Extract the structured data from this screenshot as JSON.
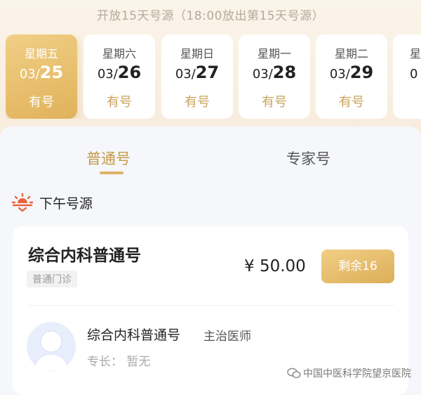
{
  "notice": "开放15天号源（18:00放出第15天号源）",
  "dates": [
    {
      "weekday": "星期五",
      "month": "03/",
      "day": "25",
      "status": "有号",
      "selected": true
    },
    {
      "weekday": "星期六",
      "month": "03/",
      "day": "26",
      "status": "有号",
      "selected": false
    },
    {
      "weekday": "星期日",
      "month": "03/",
      "day": "27",
      "status": "有号",
      "selected": false
    },
    {
      "weekday": "星期一",
      "month": "03/",
      "day": "28",
      "status": "有号",
      "selected": false
    },
    {
      "weekday": "星期二",
      "month": "03/",
      "day": "29",
      "status": "有号",
      "selected": false
    },
    {
      "weekday": "星",
      "month": "0",
      "day": "",
      "status": "",
      "selected": false
    }
  ],
  "tabs": {
    "general": "普通号",
    "expert": "专家号"
  },
  "section": {
    "icon": "sunset-icon",
    "label": "下午号源"
  },
  "slot": {
    "dept_name": "综合内科普通号",
    "dept_type": "普通门诊",
    "price": "¥ 50.00",
    "remaining": "剩余16",
    "doctor_name": "综合内科普通号",
    "doctor_title": "主治医师",
    "specialty": "专长：  暂无"
  },
  "watermark": "中国中医科学院望京医院",
  "colors": {
    "accent": "#dcb56a",
    "accent_text": "#c59a4a",
    "sun_icon": "#e8643c"
  }
}
